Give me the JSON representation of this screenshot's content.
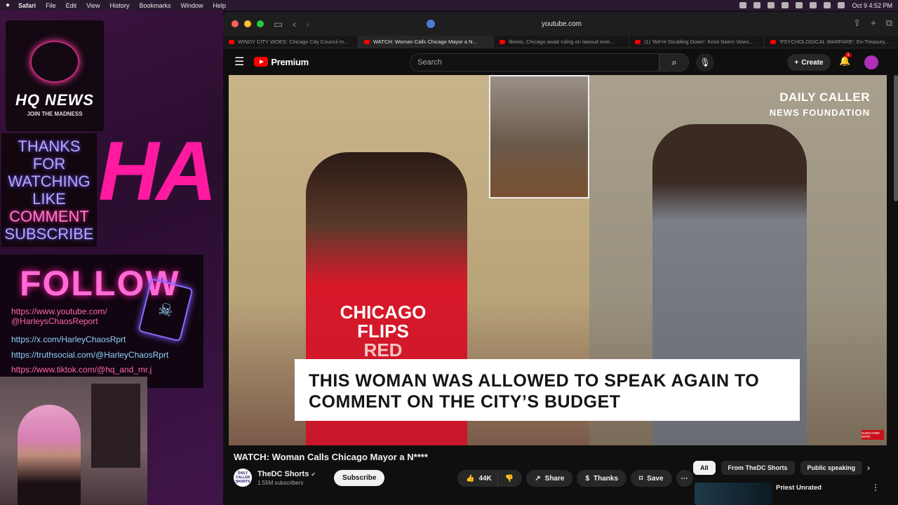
{
  "menubar": {
    "app": "Safari",
    "menus": [
      "File",
      "Edit",
      "View",
      "History",
      "Bookmarks",
      "Window",
      "Help"
    ],
    "clock": "Oct 9  4:52 PM"
  },
  "overlay": {
    "logo_title": "HQ NEWS",
    "logo_sub": "JOIN THE MADNESS",
    "thanks_lines": [
      "THANKS",
      "FOR",
      "WATCHING",
      "LIKE",
      "COMMENT",
      "SUBSCRIBE"
    ],
    "big_text": "HA",
    "follow": "FOLLOW",
    "links": [
      "https://www.youtube.com/\n@HarleysChaosReport",
      "https://x.com/HarleyChaosRprt",
      "https://truthsocial.com/@HarleyChaosRprt",
      "https://www.tiktok.com/@hq_and_mr.j"
    ]
  },
  "browser": {
    "url": "youtube.com",
    "tabs": [
      {
        "label": "WINDY CITY WOES: Chicago City Council m...",
        "active": false
      },
      {
        "label": "WATCH: Woman Calls Chicago Mayor a N...",
        "active": true
      },
      {
        "label": "Illinois, Chicago await ruling on lawsuit over...",
        "active": false
      },
      {
        "label": "(1) 'We're Doubling Down': Kristi Noem Vows...",
        "active": false
      },
      {
        "label": "'PSYCHOLOGICAL WARFARE': Ex-Treasury...",
        "active": false
      }
    ]
  },
  "youtube": {
    "logo": "Premium",
    "search_placeholder": "Search",
    "create": "Create",
    "notif_count": "1",
    "video": {
      "brand_line1": "DAILY CALLER",
      "brand_line2": "NEWS FOUNDATION",
      "shirt_line1": "CHICAGO",
      "shirt_line2": "FLIPS",
      "shirt_line3": "RED",
      "caption": "THIS WOMAN WAS ALLOWED TO SPEAK AGAIN TO COMMENT ON THE CITY’S BUDGET",
      "subscribe_badge": "SUBSCRIBE HERE"
    },
    "title": "WATCH: Woman Calls Chicago Mayor a N****",
    "channel": {
      "avatar_text": "DAILY CALLER SHORTS",
      "name": "TheDC Shorts",
      "subscribers": "1.55M subscribers",
      "subscribe": "Subscribe"
    },
    "actions": {
      "likes": "44K",
      "share": "Share",
      "thanks": "Thanks",
      "save": "Save"
    },
    "chips": [
      "All",
      "From TheDC Shorts",
      "Public speaking"
    ],
    "recommendation": {
      "title": "Priest Unrated"
    }
  },
  "colors": {
    "accent": "#ff0000",
    "overlay_pink": "#ff1aa0",
    "neon_purple": "#8d6bff"
  }
}
